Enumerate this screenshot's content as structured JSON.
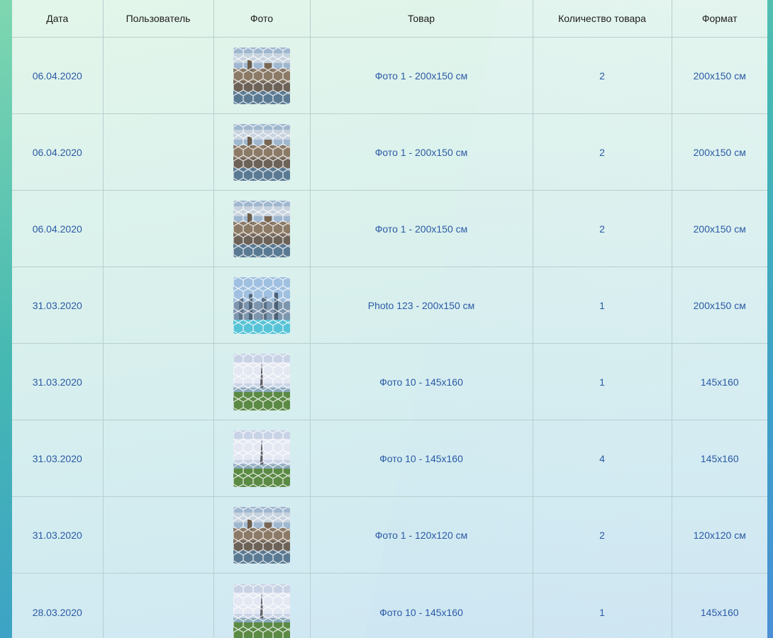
{
  "table": {
    "headers": {
      "date": "Дата",
      "user": "Пользователь",
      "photo": "Фото",
      "product": "Товар",
      "quantity": "Количество товара",
      "format": "Формат"
    },
    "rows": [
      {
        "date": "06.04.2020",
        "user": "",
        "photo": "city-castle",
        "product": "Фото 1 - 200x150 см",
        "quantity": "2",
        "format": "200x150 см"
      },
      {
        "date": "06.04.2020",
        "user": "",
        "photo": "city-castle",
        "product": "Фото 1 - 200x150 см",
        "quantity": "2",
        "format": "200x150 см"
      },
      {
        "date": "06.04.2020",
        "user": "",
        "photo": "city-castle",
        "product": "Фото 1 - 200x150 см",
        "quantity": "2",
        "format": "200x150 см"
      },
      {
        "date": "31.03.2020",
        "user": "",
        "photo": "skyline",
        "product": "Photo 123 - 200x150 см",
        "quantity": "1",
        "format": "200x150 см"
      },
      {
        "date": "31.03.2020",
        "user": "",
        "photo": "eiffel-tower",
        "product": "Фото 10 - 145x160",
        "quantity": "1",
        "format": "145x160"
      },
      {
        "date": "31.03.2020",
        "user": "",
        "photo": "eiffel-tower",
        "product": "Фото 10 - 145x160",
        "quantity": "4",
        "format": "145x160"
      },
      {
        "date": "31.03.2020",
        "user": "",
        "photo": "city-castle",
        "product": "Фото 1 - 120x120 см",
        "quantity": "2",
        "format": "120x120 см"
      },
      {
        "date": "28.03.2020",
        "user": "",
        "photo": "eiffel-tower",
        "product": "Фото 10 - 145x160",
        "quantity": "1",
        "format": "145x160"
      }
    ]
  },
  "colors": {
    "text_link": "#2b5aa5",
    "header_text": "#1c1c1c",
    "grid_line": "#b7cfcf"
  }
}
